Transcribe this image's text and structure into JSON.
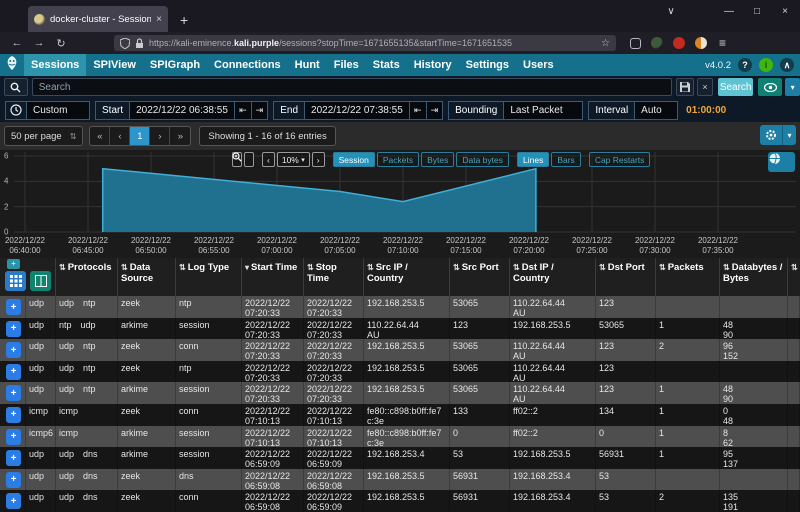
{
  "browser": {
    "tab_title": "docker-cluster - Sessions",
    "url_prefix": "https://kali-eminence.",
    "url_domain": "kali.purple",
    "url_path": "/sessions?stopTime=1671655135&startTime=1671651535"
  },
  "icons": {
    "back": "←",
    "forward": "→",
    "reload": "↻",
    "star": "☆",
    "menu": "≡",
    "win_chevron": "∨",
    "win_min": "—",
    "win_max": "□",
    "win_close": "×",
    "tab_close": "×",
    "new_tab": "+",
    "help": "?",
    "health": "i",
    "collapse": "∧",
    "clear": "×",
    "caret_down": "▾",
    "skip_back": "⇤",
    "skip_fwd": "⇥",
    "first": "«",
    "prev": "‹",
    "next": "›",
    "last": "»",
    "pan_left": "‹",
    "pan_right": "›",
    "sort_both": "⇅",
    "sort_down": "▾",
    "plus": "+",
    "per_page_caret": "⇅"
  },
  "navbar": {
    "version": "v4.0.2",
    "items": [
      {
        "label": "Sessions",
        "active": true
      },
      {
        "label": "SPIView",
        "active": false
      },
      {
        "label": "SPIGraph",
        "active": false
      },
      {
        "label": "Connections",
        "active": false
      },
      {
        "label": "Hunt",
        "active": false
      },
      {
        "label": "Files",
        "active": false
      },
      {
        "label": "Stats",
        "active": false
      },
      {
        "label": "History",
        "active": false
      },
      {
        "label": "Settings",
        "active": false
      },
      {
        "label": "Users",
        "active": false
      }
    ]
  },
  "search": {
    "placeholder": "Search",
    "search_button": "Search"
  },
  "timebar": {
    "range_value": "Custom",
    "start_label": "Start",
    "start_value": "2022/12/22 06:38:55",
    "end_label": "End",
    "end_value": "2022/12/22 07:38:55",
    "bounding_label": "Bounding",
    "bounding_value": "Last Packet",
    "interval_label": "Interval",
    "interval_value": "Auto",
    "duration": "01:00:00"
  },
  "pagination": {
    "per_page": "50 per page",
    "page": "1",
    "summary": "Showing 1 - 16 of 16 entries"
  },
  "chart_controls": {
    "zoom_level": "10%",
    "metric_toggles": [
      {
        "label": "Session",
        "active": true
      },
      {
        "label": "Packets",
        "active": false
      },
      {
        "label": "Bytes",
        "active": false
      },
      {
        "label": "Data bytes",
        "active": false
      }
    ],
    "style_toggles": [
      {
        "label": "Lines",
        "active": true
      },
      {
        "label": "Bars",
        "active": false
      }
    ],
    "extra_toggle": {
      "label": "Cap Restarts",
      "active": false
    }
  },
  "chart_data": {
    "type": "area",
    "series_name": "Session",
    "x_start": "2022/12/22 06:38:55",
    "x_end": "2022/12/22 07:38:55",
    "x_tick_date": "2022/12/22",
    "x_tick_times": [
      "06:40:00",
      "06:45:00",
      "06:50:00",
      "06:55:00",
      "07:00:00",
      "07:05:00",
      "07:10:00",
      "07:15:00",
      "07:20:00",
      "07:25:00",
      "07:30:00",
      "07:35:00"
    ],
    "y_ticks": [
      0,
      2,
      4,
      6
    ],
    "ylim": [
      0,
      6
    ],
    "grid": true,
    "baseline": 0,
    "points": [
      {
        "time": "06:46:10",
        "value": 5.0
      },
      {
        "time": "07:05:00",
        "value": 3.2
      },
      {
        "time": "07:10:00",
        "value": 2.4
      },
      {
        "time": "07:20:33",
        "value": 5.0
      }
    ],
    "fill_color": "#20708f",
    "line_color": "#3fb0d8"
  },
  "table": {
    "headers": [
      {
        "label": "Protocols",
        "sort": "both"
      },
      {
        "label": "Data Source",
        "sort": "both"
      },
      {
        "label": "Log Type",
        "sort": "both"
      },
      {
        "label": "Start Time",
        "sort": "down"
      },
      {
        "label": "Stop Time",
        "sort": "both"
      },
      {
        "label": "Src IP / Country",
        "sort": "both"
      },
      {
        "label": "Src Port",
        "sort": "both"
      },
      {
        "label": "Dst IP / Country",
        "sort": "both"
      },
      {
        "label": "Dst Port",
        "sort": "both"
      },
      {
        "label": "Packets",
        "sort": "both"
      },
      {
        "label": "Databytes / Bytes",
        "sort": "both"
      }
    ],
    "rows": [
      {
        "protocol": "udp",
        "protocols": [
          "udp",
          "ntp"
        ],
        "data_source": "zeek",
        "log_type": "ntp",
        "start_time": "2022/12/22 07:20:33",
        "stop_time": "2022/12/22 07:20:33",
        "src_ip": "192.168.253.5",
        "src_country": "",
        "src_port": "53065",
        "dst_ip": "110.22.64.44",
        "dst_country": "AU",
        "dst_port": "123",
        "packets": "",
        "databytes": "",
        "bytes": ""
      },
      {
        "protocol": "udp",
        "protocols": [
          "ntp",
          "udp"
        ],
        "data_source": "arkime",
        "log_type": "session",
        "start_time": "2022/12/22 07:20:33",
        "stop_time": "2022/12/22 07:20:33",
        "src_ip": "110.22.64.44",
        "src_country": "AU",
        "src_port": "123",
        "dst_ip": "192.168.253.5",
        "dst_country": "",
        "dst_port": "53065",
        "packets": "1",
        "databytes": "48",
        "bytes": "90"
      },
      {
        "protocol": "udp",
        "protocols": [
          "udp",
          "ntp"
        ],
        "data_source": "zeek",
        "log_type": "conn",
        "start_time": "2022/12/22 07:20:33",
        "stop_time": "2022/12/22 07:20:33",
        "src_ip": "192.168.253.5",
        "src_country": "",
        "src_port": "53065",
        "dst_ip": "110.22.64.44",
        "dst_country": "AU",
        "dst_port": "123",
        "packets": "2",
        "databytes": "96",
        "bytes": "152"
      },
      {
        "protocol": "udp",
        "protocols": [
          "udp",
          "ntp"
        ],
        "data_source": "zeek",
        "log_type": "ntp",
        "start_time": "2022/12/22 07:20:33",
        "stop_time": "2022/12/22 07:20:33",
        "src_ip": "192.168.253.5",
        "src_country": "",
        "src_port": "53065",
        "dst_ip": "110.22.64.44",
        "dst_country": "AU",
        "dst_port": "123",
        "packets": "",
        "databytes": "",
        "bytes": ""
      },
      {
        "protocol": "udp",
        "protocols": [
          "udp",
          "ntp"
        ],
        "data_source": "arkime",
        "log_type": "session",
        "start_time": "2022/12/22 07:20:33",
        "stop_time": "2022/12/22 07:20:33",
        "src_ip": "192.168.253.5",
        "src_country": "",
        "src_port": "53065",
        "dst_ip": "110.22.64.44",
        "dst_country": "AU",
        "dst_port": "123",
        "packets": "1",
        "databytes": "48",
        "bytes": "90"
      },
      {
        "protocol": "icmp",
        "protocols": [
          "icmp"
        ],
        "data_source": "zeek",
        "log_type": "conn",
        "start_time": "2022/12/22 07:10:13",
        "stop_time": "2022/12/22 07:10:13",
        "src_ip": "fe80::c898:b0ff:fe7c:3e",
        "src_country": "",
        "src_port": "133",
        "dst_ip": "ff02::2",
        "dst_country": "",
        "dst_port": "134",
        "packets": "1",
        "databytes": "0",
        "bytes": "48"
      },
      {
        "protocol": "icmp6",
        "protocols": [
          "icmp"
        ],
        "data_source": "arkime",
        "log_type": "session",
        "start_time": "2022/12/22 07:10:13",
        "stop_time": "2022/12/22 07:10:13",
        "src_ip": "fe80::c898:b0ff:fe7c:3e",
        "src_country": "",
        "src_port": "0",
        "dst_ip": "ff02::2",
        "dst_country": "",
        "dst_port": "0",
        "packets": "1",
        "databytes": "8",
        "bytes": "62"
      },
      {
        "protocol": "udp",
        "protocols": [
          "udp",
          "dns"
        ],
        "data_source": "arkime",
        "log_type": "session",
        "start_time": "2022/12/22 06:59:09",
        "stop_time": "2022/12/22 06:59:09",
        "src_ip": "192.168.253.4",
        "src_country": "",
        "src_port": "53",
        "dst_ip": "192.168.253.5",
        "dst_country": "",
        "dst_port": "56931",
        "packets": "1",
        "databytes": "95",
        "bytes": "137"
      },
      {
        "protocol": "udp",
        "protocols": [
          "udp",
          "dns"
        ],
        "data_source": "zeek",
        "log_type": "dns",
        "start_time": "2022/12/22 06:59:08",
        "stop_time": "2022/12/22 06:59:08",
        "src_ip": "192.168.253.5",
        "src_country": "",
        "src_port": "56931",
        "dst_ip": "192.168.253.4",
        "dst_country": "",
        "dst_port": "53",
        "packets": "",
        "databytes": "",
        "bytes": ""
      },
      {
        "protocol": "udp",
        "protocols": [
          "udp",
          "dns"
        ],
        "data_source": "zeek",
        "log_type": "conn",
        "start_time": "2022/12/22 06:59:08",
        "stop_time": "2022/12/22 06:59:09",
        "src_ip": "192.168.253.5",
        "src_country": "",
        "src_port": "56931",
        "dst_ip": "192.168.253.4",
        "dst_country": "",
        "dst_port": "53",
        "packets": "2",
        "databytes": "135",
        "bytes": "191"
      }
    ]
  }
}
